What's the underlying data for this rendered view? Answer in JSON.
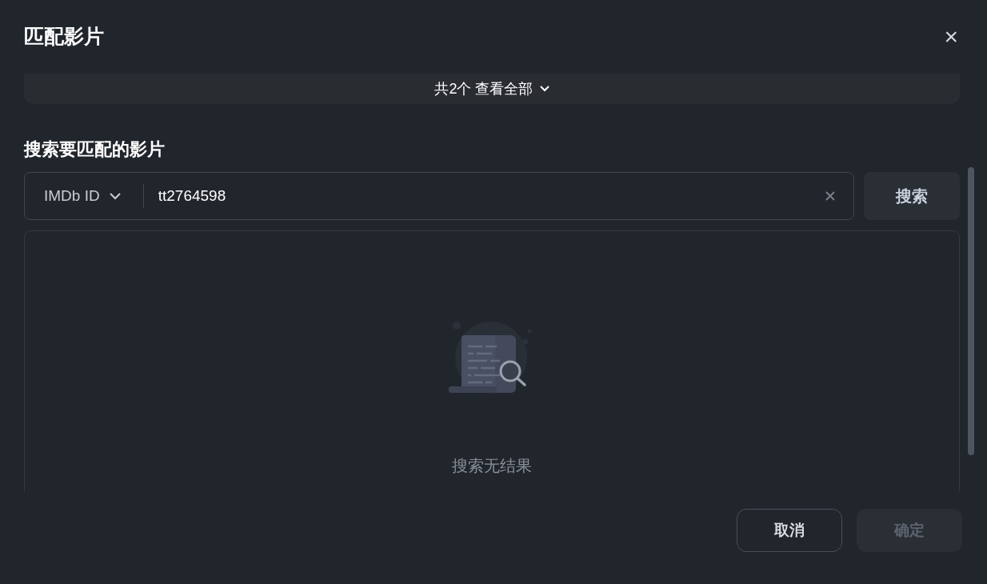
{
  "dialog": {
    "title": "匹配影片",
    "close_icon": "×"
  },
  "summary": {
    "text": "共2个 查看全部"
  },
  "search": {
    "label": "搜索要匹配的影片",
    "type_select": "IMDb ID",
    "value": "tt2764598",
    "button": "搜索"
  },
  "results": {
    "empty_text": "搜索无结果"
  },
  "footer": {
    "buttons": [
      {
        "label": "取消",
        "kind": "secondary",
        "disabled": false
      },
      {
        "label": "确定",
        "kind": "primary",
        "disabled": true
      }
    ]
  }
}
